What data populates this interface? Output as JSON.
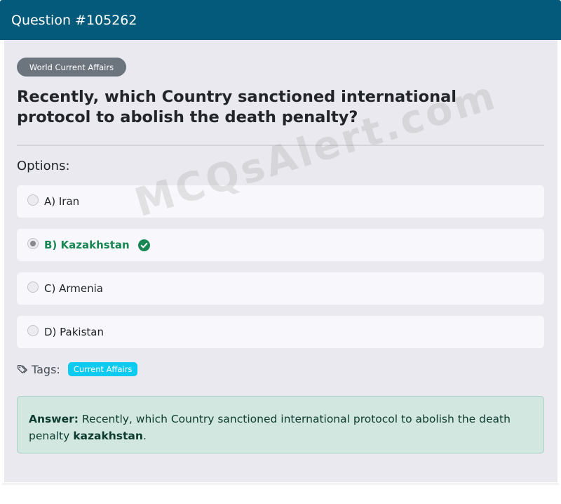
{
  "header": {
    "title": "Question #105262"
  },
  "category": {
    "label": "World Current Affairs"
  },
  "question": {
    "text": "Recently, which Country sanctioned international protocol to abolish the death penalty?"
  },
  "options_label": "Options:",
  "options": [
    {
      "label": "A) Iran",
      "selected": false,
      "correct": false
    },
    {
      "label": "B) Kazakhstan",
      "selected": true,
      "correct": true
    },
    {
      "label": "C) Armenia",
      "selected": false,
      "correct": false
    },
    {
      "label": "D) Pakistan",
      "selected": false,
      "correct": false
    }
  ],
  "tags": {
    "label": "Tags:",
    "items": [
      "Current Affairs"
    ]
  },
  "answer": {
    "label": "Answer:",
    "text": "Recently, which Country sanctioned international protocol to abolish the death penalty",
    "value": "kazakhstan",
    "suffix": "."
  },
  "watermark": "MCQsAlert.com",
  "colors": {
    "header_bg": "#045a7a",
    "correct_green": "#198754",
    "tag_badge": "#0dcaf0",
    "category_badge": "#6c757d",
    "answer_bg": "#d1e7e0"
  }
}
